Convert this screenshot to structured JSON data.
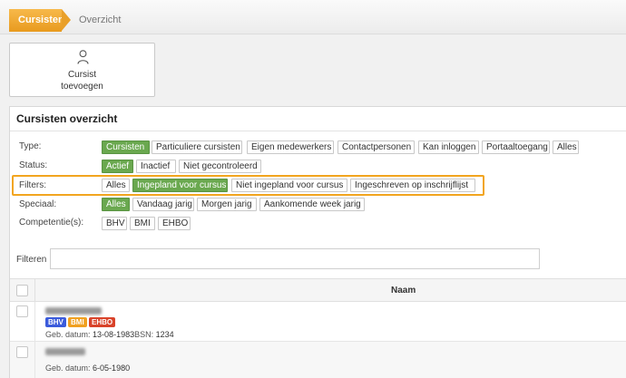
{
  "breadcrumb": {
    "active": "Cursisten",
    "next": "Overzicht"
  },
  "add_button": {
    "line1": "Cursist",
    "line2": "toevoegen",
    "icon": "user-icon"
  },
  "panel": {
    "title": "Cursisten overzicht"
  },
  "filters": {
    "type": {
      "label": "Type:",
      "options": [
        "Cursisten",
        "Particuliere cursisten",
        "Eigen medewerkers",
        "Contactpersonen",
        "Kan inloggen",
        "Portaaltoegang",
        "Alles"
      ],
      "selected": "Cursisten"
    },
    "status": {
      "label": "Status:",
      "options": [
        "Actief",
        "Inactief",
        "Niet gecontroleerd"
      ],
      "selected": "Actief"
    },
    "filters": {
      "label": "Filters:",
      "options": [
        "Alles",
        "Ingepland voor cursus",
        "Niet ingepland voor cursus",
        "Ingeschreven op inschrijflijst"
      ],
      "selected": "Ingepland voor cursus"
    },
    "speciaal": {
      "label": "Speciaal:",
      "options": [
        "Alles",
        "Vandaag jarig",
        "Morgen jarig",
        "Aankomende week jarig"
      ],
      "selected": "Alles"
    },
    "competentie": {
      "label": "Competentie(s):",
      "options": [
        "BHV",
        "BMI",
        "EHBO"
      ]
    }
  },
  "search": {
    "label": "Filteren",
    "value": "",
    "placeholder": ""
  },
  "table": {
    "columns": [
      "Naam"
    ],
    "rows": [
      {
        "badges": [
          {
            "label": "BHV",
            "color": "#3b5bdb"
          },
          {
            "label": "BMI",
            "color": "#f0a020"
          },
          {
            "label": "EHBO",
            "color": "#d9432a"
          }
        ],
        "dob_label": "Geb. datum:",
        "dob": "13-08-1983",
        "bsn_label": "BSN:",
        "bsn": "1234"
      },
      {
        "badges": [],
        "dob_label": "Geb. datum:",
        "dob": "6-05-1980"
      }
    ]
  },
  "colors": {
    "accent": "#f2a51f",
    "selected": "#6aa84f"
  }
}
